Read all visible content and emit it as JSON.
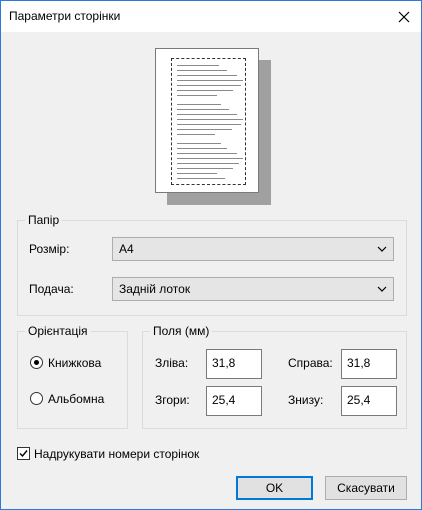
{
  "window": {
    "title": "Параметри сторінки"
  },
  "paper": {
    "group_label": "Папір",
    "size_label": "Розмір:",
    "size_value": "A4",
    "source_label": "Подача:",
    "source_value": "Задній лоток"
  },
  "orientation": {
    "group_label": "Орієнтація",
    "portrait_label": "Книжкова",
    "landscape_label": "Альбомна",
    "selected": "portrait"
  },
  "margins": {
    "group_label": "Поля (мм)",
    "left_label": "Зліва:",
    "left_value": "31,8",
    "right_label": "Справа:",
    "right_value": "31,8",
    "top_label": "Згори:",
    "top_value": "25,4",
    "bottom_label": "Знизу:",
    "bottom_value": "25,4"
  },
  "print_page_numbers": {
    "label": "Надрукувати номери сторінок",
    "checked": true
  },
  "buttons": {
    "ok": "OK",
    "cancel": "Скасувати"
  },
  "icons": {
    "close": "close-icon",
    "dropdown": "chevron-down-icon",
    "check": "checkmark-icon"
  }
}
